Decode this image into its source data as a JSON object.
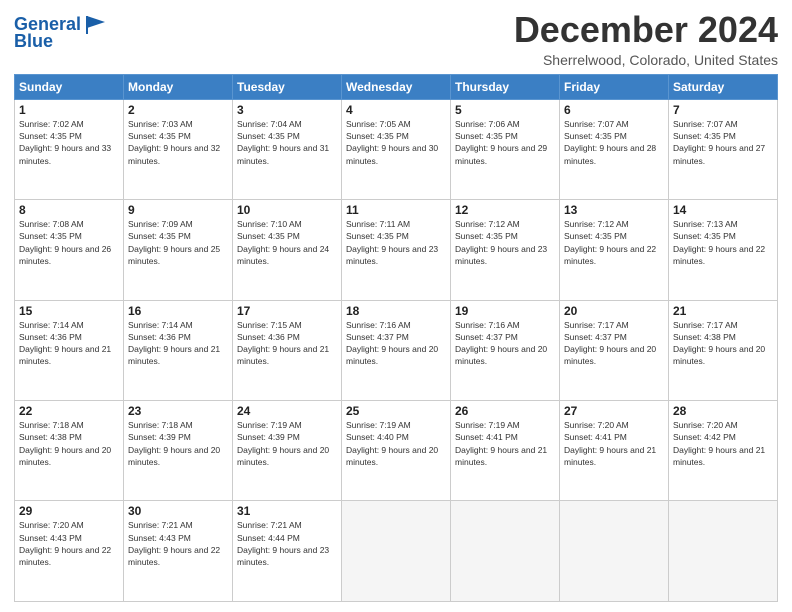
{
  "header": {
    "logo_line1": "General",
    "logo_line2": "Blue",
    "month_title": "December 2024",
    "location": "Sherrelwood, Colorado, United States"
  },
  "days_of_week": [
    "Sunday",
    "Monday",
    "Tuesday",
    "Wednesday",
    "Thursday",
    "Friday",
    "Saturday"
  ],
  "weeks": [
    [
      {
        "day": 1,
        "sunrise": "7:02 AM",
        "sunset": "4:35 PM",
        "daylight": "9 hours and 33 minutes."
      },
      {
        "day": 2,
        "sunrise": "7:03 AM",
        "sunset": "4:35 PM",
        "daylight": "9 hours and 32 minutes."
      },
      {
        "day": 3,
        "sunrise": "7:04 AM",
        "sunset": "4:35 PM",
        "daylight": "9 hours and 31 minutes."
      },
      {
        "day": 4,
        "sunrise": "7:05 AM",
        "sunset": "4:35 PM",
        "daylight": "9 hours and 30 minutes."
      },
      {
        "day": 5,
        "sunrise": "7:06 AM",
        "sunset": "4:35 PM",
        "daylight": "9 hours and 29 minutes."
      },
      {
        "day": 6,
        "sunrise": "7:07 AM",
        "sunset": "4:35 PM",
        "daylight": "9 hours and 28 minutes."
      },
      {
        "day": 7,
        "sunrise": "7:07 AM",
        "sunset": "4:35 PM",
        "daylight": "9 hours and 27 minutes."
      }
    ],
    [
      {
        "day": 8,
        "sunrise": "7:08 AM",
        "sunset": "4:35 PM",
        "daylight": "9 hours and 26 minutes."
      },
      {
        "day": 9,
        "sunrise": "7:09 AM",
        "sunset": "4:35 PM",
        "daylight": "9 hours and 25 minutes."
      },
      {
        "day": 10,
        "sunrise": "7:10 AM",
        "sunset": "4:35 PM",
        "daylight": "9 hours and 24 minutes."
      },
      {
        "day": 11,
        "sunrise": "7:11 AM",
        "sunset": "4:35 PM",
        "daylight": "9 hours and 23 minutes."
      },
      {
        "day": 12,
        "sunrise": "7:12 AM",
        "sunset": "4:35 PM",
        "daylight": "9 hours and 23 minutes."
      },
      {
        "day": 13,
        "sunrise": "7:12 AM",
        "sunset": "4:35 PM",
        "daylight": "9 hours and 22 minutes."
      },
      {
        "day": 14,
        "sunrise": "7:13 AM",
        "sunset": "4:35 PM",
        "daylight": "9 hours and 22 minutes."
      }
    ],
    [
      {
        "day": 15,
        "sunrise": "7:14 AM",
        "sunset": "4:36 PM",
        "daylight": "9 hours and 21 minutes."
      },
      {
        "day": 16,
        "sunrise": "7:14 AM",
        "sunset": "4:36 PM",
        "daylight": "9 hours and 21 minutes."
      },
      {
        "day": 17,
        "sunrise": "7:15 AM",
        "sunset": "4:36 PM",
        "daylight": "9 hours and 21 minutes."
      },
      {
        "day": 18,
        "sunrise": "7:16 AM",
        "sunset": "4:37 PM",
        "daylight": "9 hours and 20 minutes."
      },
      {
        "day": 19,
        "sunrise": "7:16 AM",
        "sunset": "4:37 PM",
        "daylight": "9 hours and 20 minutes."
      },
      {
        "day": 20,
        "sunrise": "7:17 AM",
        "sunset": "4:37 PM",
        "daylight": "9 hours and 20 minutes."
      },
      {
        "day": 21,
        "sunrise": "7:17 AM",
        "sunset": "4:38 PM",
        "daylight": "9 hours and 20 minutes."
      }
    ],
    [
      {
        "day": 22,
        "sunrise": "7:18 AM",
        "sunset": "4:38 PM",
        "daylight": "9 hours and 20 minutes."
      },
      {
        "day": 23,
        "sunrise": "7:18 AM",
        "sunset": "4:39 PM",
        "daylight": "9 hours and 20 minutes."
      },
      {
        "day": 24,
        "sunrise": "7:19 AM",
        "sunset": "4:39 PM",
        "daylight": "9 hours and 20 minutes."
      },
      {
        "day": 25,
        "sunrise": "7:19 AM",
        "sunset": "4:40 PM",
        "daylight": "9 hours and 20 minutes."
      },
      {
        "day": 26,
        "sunrise": "7:19 AM",
        "sunset": "4:41 PM",
        "daylight": "9 hours and 21 minutes."
      },
      {
        "day": 27,
        "sunrise": "7:20 AM",
        "sunset": "4:41 PM",
        "daylight": "9 hours and 21 minutes."
      },
      {
        "day": 28,
        "sunrise": "7:20 AM",
        "sunset": "4:42 PM",
        "daylight": "9 hours and 21 minutes."
      }
    ],
    [
      {
        "day": 29,
        "sunrise": "7:20 AM",
        "sunset": "4:43 PM",
        "daylight": "9 hours and 22 minutes."
      },
      {
        "day": 30,
        "sunrise": "7:21 AM",
        "sunset": "4:43 PM",
        "daylight": "9 hours and 22 minutes."
      },
      {
        "day": 31,
        "sunrise": "7:21 AM",
        "sunset": "4:44 PM",
        "daylight": "9 hours and 23 minutes."
      },
      null,
      null,
      null,
      null
    ]
  ]
}
